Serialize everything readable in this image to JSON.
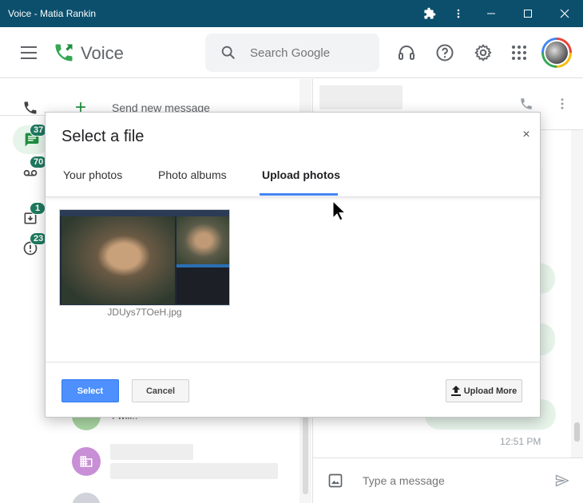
{
  "window": {
    "title": "Voice - Matia Rankin",
    "extensions_icon": "puzzle-icon",
    "menu_icon": "more-vert-icon"
  },
  "appbar": {
    "brand": "Voice",
    "search_placeholder": "Search Google",
    "brand_color": "#34a853"
  },
  "rail": {
    "badges": {
      "messages": "37",
      "voicemail": "70",
      "archive": "1",
      "spam": "23"
    }
  },
  "conversations": {
    "send_new_label": "Send new message",
    "snippet": "I will!!"
  },
  "thread": {
    "time": "12:51 PM",
    "composer_placeholder": "Type a message"
  },
  "modal": {
    "title": "Select a file",
    "close": "×",
    "tabs": [
      "Your photos",
      "Photo albums",
      "Upload photos"
    ],
    "active_tab": "Upload photos",
    "photo": {
      "filename": "JDUys7TOeH.jpg"
    },
    "select_label": "Select",
    "cancel_label": "Cancel",
    "upload_more_label": "Upload More",
    "accent_color": "#4d90fe"
  }
}
